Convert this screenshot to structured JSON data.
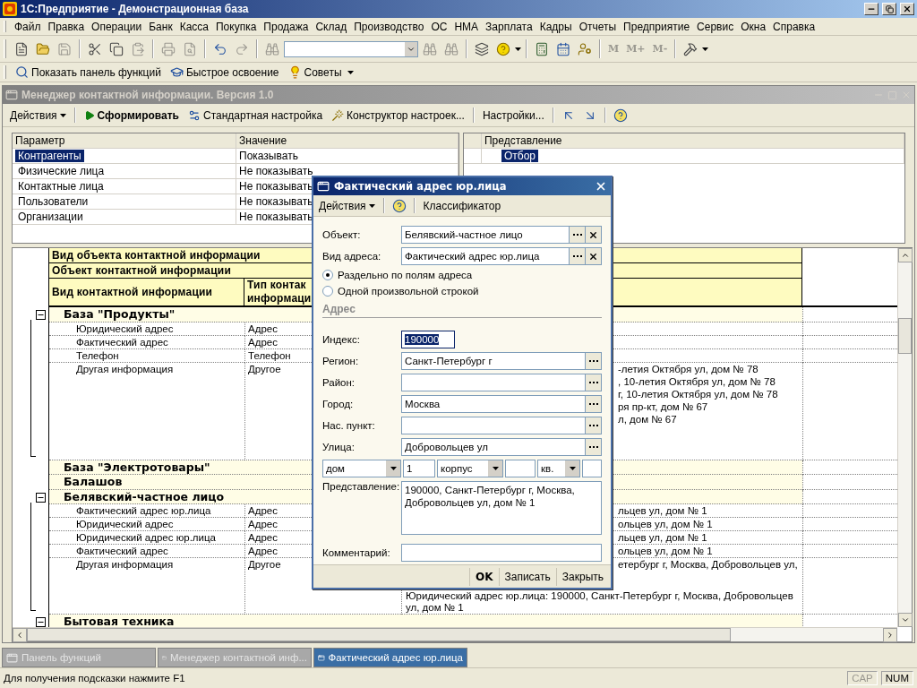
{
  "window": {
    "title": "1С:Предприятие - Демонстрационная база"
  },
  "menu": [
    "Файл",
    "Правка",
    "Операции",
    "Банк",
    "Касса",
    "Покупка",
    "Продажа",
    "Склад",
    "Производство",
    "ОС",
    "НМА",
    "Зарплата",
    "Кадры",
    "Отчеты",
    "Предприятие",
    "Сервис",
    "Окна",
    "Справка"
  ],
  "toolbar": {
    "memory_buttons": [
      {
        "label": "M",
        "disabled": true
      },
      {
        "label": "M+",
        "disabled": true
      },
      {
        "label": "M-",
        "disabled": true
      }
    ]
  },
  "quick_bar": [
    "Показать панель функций",
    "Быстрое освоение",
    "Советы"
  ],
  "child_window": {
    "title": "Менеджер контактной информации. Версия 1.0",
    "active": false,
    "toolbar": {
      "actions": "Действия",
      "generate": "Сформировать",
      "buttons": [
        "Стандартная настройка",
        "Конструктор настроек...",
        "Настройки..."
      ]
    },
    "params": {
      "columns": [
        "Параметр",
        "Значение"
      ],
      "rows": [
        {
          "name": "Контрагенты",
          "value": "Показывать",
          "selected": true
        },
        {
          "name": "Физические лица",
          "value": "Не показывать",
          "selected": false
        },
        {
          "name": "Контактные лица",
          "value": "Не показывать",
          "selected": false
        },
        {
          "name": "Пользователи",
          "value": "Не показывать",
          "selected": false
        },
        {
          "name": "Организации",
          "value": "Не показывать",
          "selected": false
        }
      ]
    },
    "presentation": {
      "column": "Представление",
      "rows": [
        {
          "name": "Отбор",
          "selected": true
        }
      ]
    },
    "report": {
      "header": {
        "object_kind": "Вид объекта контактной информации",
        "object": "Объект контактной информации",
        "info_kind": "Вид контактной информации",
        "info_type": "Тип контак\nинформаци"
      },
      "groups": [
        {
          "name": "База \"Продукты\"",
          "expanded": true,
          "children": [
            {
              "name": "Юридический адрес",
              "type": "Адрес"
            },
            {
              "name": "Фактический адрес",
              "type": "Адрес"
            },
            {
              "name": "Телефон",
              "type": "Телефон"
            },
            {
              "name": "Другая информация",
              "type": "Другое",
              "lines": [
                {
                  "text": "-летия Октября ул, дом № 78",
                  "cut": true
                },
                {
                  "text": ", 10-летия Октября ул, дом № 78",
                  "cut": true
                },
                {
                  "text": "г, 10-летия Октября ул, дом № 78",
                  "cut": true
                },
                {
                  "text": "ря пр-кт, дом № 67",
                  "cut": true
                },
                {
                  "text": "л, дом № 67",
                  "cut": true
                }
              ]
            }
          ]
        },
        {
          "name": "База \"Электротовары\"",
          "expanded": false
        },
        {
          "name": "Балашов",
          "expanded": false
        },
        {
          "name": "Белявский-частное лицо",
          "expanded": true,
          "children": [
            {
              "name": "Фактический адрес юр.лица",
              "type": "Адрес",
              "lines": [
                {
                  "text": "льцев ул, дом № 1",
                  "cut": true
                }
              ]
            },
            {
              "name": "Юридический адрес",
              "type": "Адрес",
              "lines": [
                {
                  "text": "ольцев ул, дом № 1",
                  "cut": true
                }
              ]
            },
            {
              "name": "Юридический адрес юр.лица",
              "type": "Адрес",
              "lines": [
                {
                  "text": "льцев ул, дом № 1",
                  "cut": true
                }
              ]
            },
            {
              "name": "Фактический адрес",
              "type": "Адрес",
              "lines": [
                {
                  "text": "ольцев ул, дом № 1",
                  "cut": true
                }
              ]
            },
            {
              "name": "Другая информация",
              "type": "Другое",
              "lines": [
                {
                  "text": "етербург г, Москва, Добровольцев ул,",
                  "cut": true
                },
                {
                  "text": "Юридический адрес юр.лица: 190000, Санкт-Петербург г, Москва, Добровольцев ул, дом № 1",
                  "cut": false
                }
              ]
            }
          ]
        },
        {
          "name": "Бытовая техника",
          "expanded": true
        }
      ]
    }
  },
  "dialog": {
    "title": "Фактический адрес юр.лица",
    "toolbar": {
      "actions": "Действия",
      "buttons": [
        "Классификатор"
      ]
    },
    "top_fields": [
      {
        "label": "Объект:",
        "value": "Белявский-частное лицо"
      },
      {
        "label": "Вид адреса:",
        "value": "Фактический адрес юр.лица"
      }
    ],
    "modes": [
      {
        "label": "Раздельно по полям адреса",
        "selected": true
      },
      {
        "label": "Одной произвольной строкой",
        "selected": false
      }
    ],
    "section": "Адрес",
    "address_fields": [
      {
        "kind": "index",
        "label": "Индекс:",
        "value": "190000",
        "highlighted": true
      },
      {
        "kind": "select",
        "label": "Регион:",
        "value": "Санкт-Петербург г",
        "highlighted": false
      },
      {
        "kind": "select",
        "label": "Район:",
        "highlighted": false
      },
      {
        "kind": "select",
        "label": "Город:",
        "value": "Москва",
        "highlighted": false
      },
      {
        "kind": "select",
        "label": "Нас. пункт:",
        "highlighted": false
      },
      {
        "kind": "select",
        "label": "Улица:",
        "value": "Добровольцев ул",
        "highlighted": false
      }
    ],
    "house": [
      {
        "kind": "combo",
        "value": "дом"
      },
      {
        "kind": "input",
        "value": "1"
      },
      {
        "kind": "combo",
        "value": "корпус"
      },
      {
        "kind": "input"
      },
      {
        "kind": "combo",
        "value": "кв."
      },
      {
        "kind": "input"
      }
    ],
    "presentation": {
      "label": "Представление:",
      "value": "190000, Санкт-Петербург г, Москва, Добровольцев ул, дом № 1"
    },
    "comment": {
      "label": "Комментарий:"
    },
    "buttons": [
      {
        "label": "OK",
        "default": true
      },
      {
        "label": "Записать",
        "default": false
      },
      {
        "label": "Закрыть",
        "default": false
      }
    ]
  },
  "taskbar": [
    {
      "label": "Панель функций",
      "selected": false
    },
    {
      "label": "Менеджер контактной инф...",
      "selected": false
    },
    {
      "label": "Фактический адрес юр.лица",
      "selected": true
    }
  ],
  "status_bar": {
    "hint": "Для получения подсказки нажмите F1",
    "indicators": [
      {
        "label": "CAP",
        "on": false
      },
      {
        "label": "NUM",
        "on": true
      }
    ]
  }
}
